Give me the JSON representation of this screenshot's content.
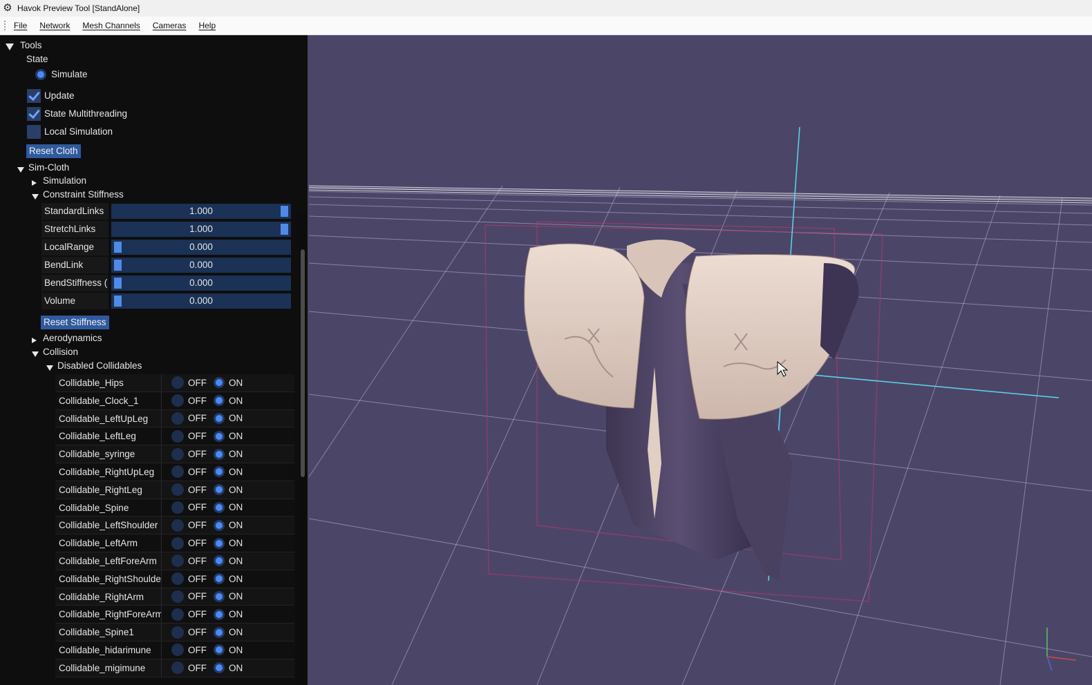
{
  "window": {
    "title": "Havok Preview Tool [StandAlone]",
    "icon": "gear-icon"
  },
  "menu": [
    "File",
    "Network",
    "Mesh Channels",
    "Cameras",
    "Help"
  ],
  "tools": {
    "header": "Tools",
    "state_label": "State",
    "simulate_label": "Simulate",
    "checkboxes": [
      {
        "label": "Update",
        "checked": true
      },
      {
        "label": "State Multithreading",
        "checked": true
      },
      {
        "label": "Local Simulation",
        "checked": false
      }
    ],
    "reset_cloth": "Reset Cloth",
    "sim_cloth": "Sim-Cloth",
    "simulation": "Simulation",
    "constraint_stiffness": "Constraint Stiffness",
    "sliders": [
      {
        "label": "StandardLinks",
        "value": "1.000",
        "fraction": 1.0
      },
      {
        "label": "StretchLinks",
        "value": "1.000",
        "fraction": 1.0
      },
      {
        "label": "LocalRange",
        "value": "0.000",
        "fraction": 0.0
      },
      {
        "label": "BendLink",
        "value": "0.000",
        "fraction": 0.0
      },
      {
        "label": "BendStiffness (",
        "value": "0.000",
        "fraction": 0.0
      },
      {
        "label": "Volume",
        "value": "0.000",
        "fraction": 0.0
      }
    ],
    "reset_stiffness": "Reset Stiffness",
    "aerodynamics": "Aerodynamics",
    "collision": "Collision",
    "disabled_collidables": "Disabled Collidables",
    "off_label": "OFF",
    "on_label": "ON",
    "collidables": [
      "Collidable_Hips",
      "Collidable_Clock_1",
      "Collidable_LeftUpLeg",
      "Collidable_LeftLeg",
      "Collidable_syringe",
      "Collidable_RightUpLeg",
      "Collidable_RightLeg",
      "Collidable_Spine",
      "Collidable_LeftShoulder",
      "Collidable_LeftArm",
      "Collidable_LeftForeArm",
      "Collidable_RightShoulder",
      "Collidable_RightArm",
      "Collidable_RightForeArm",
      "Collidable_Spine1",
      "Collidable_hidarimune",
      "Collidable_migimune"
    ]
  },
  "colors": {
    "accent": "#4a8af5",
    "viewport_bg": "#4b4668",
    "panel_bg": "#0e0e0e"
  }
}
